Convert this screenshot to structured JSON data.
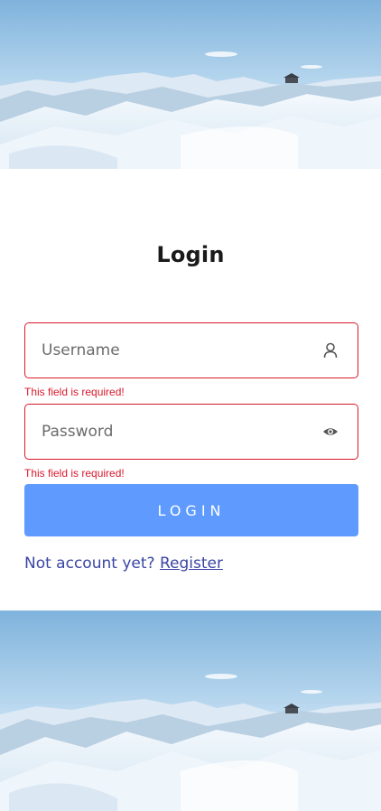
{
  "login": {
    "title": "Login",
    "username": {
      "placeholder": "Username",
      "value": "",
      "error": "This field is required!",
      "icon": "user-icon"
    },
    "password": {
      "placeholder": "Password",
      "value": "",
      "error": "This field is required!",
      "icon": "eye-icon"
    },
    "button_label": "LOGIN",
    "register_prompt": "Not account yet?",
    "register_link": "Register"
  },
  "colors": {
    "error": "#d9192b",
    "button": "#5f9bff",
    "link": "#3a46a3"
  },
  "images": {
    "top": "snowy-mountain-landscape",
    "bottom": "snowy-mountain-landscape"
  }
}
